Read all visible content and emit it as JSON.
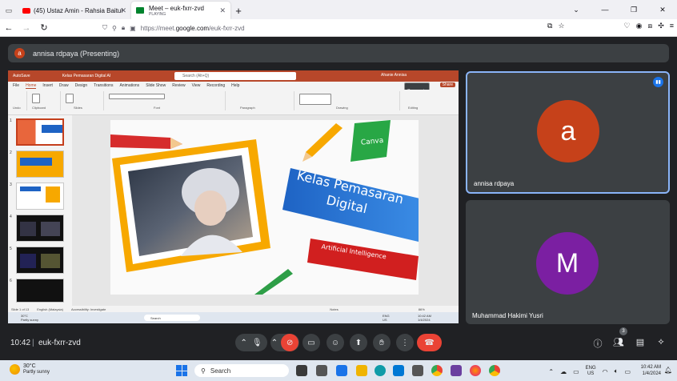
{
  "browser": {
    "tabs": [
      {
        "title": "(45) Ustaz Amin - Rahsia Baitul"
      },
      {
        "title": "Meet – euk-fxrr-zvd",
        "subtitle": "PLAYING"
      }
    ],
    "url_prefix": "https://meet.",
    "url_domain": "google.com",
    "url_path": "/euk-fxrr-zvd"
  },
  "meet": {
    "presenting_initial": "a",
    "presenting_label": "annisa rdpaya (Presenting)",
    "participants": [
      {
        "initial": "a",
        "name": "annisa rdpaya",
        "color": "#c6411a"
      },
      {
        "initial": "M",
        "name": "Muhammad Hakimi Yusri",
        "color": "#7b1fa2"
      }
    ],
    "time": "10:42",
    "separator": "|",
    "meeting_code": "euk-fxrr-zvd",
    "participant_count": "3"
  },
  "ppt": {
    "autosave": "AutoSave",
    "file_name": "Kelas Pemasaran Digital AI",
    "search": "Search (Alt+Q)",
    "user": "Ahanie Annisa",
    "menu": [
      "File",
      "Home",
      "Insert",
      "Draw",
      "Design",
      "Transitions",
      "Animations",
      "Slide Show",
      "Review",
      "View",
      "Recording",
      "Help"
    ],
    "comments": "Comments",
    "share": "Share",
    "ribbon_groups": [
      "Undo",
      "Clipboard",
      "Slides",
      "Font",
      "Paragraph",
      "Drawing",
      "Editing"
    ],
    "slide_numbers": [
      "1",
      "2",
      "3",
      "4",
      "5",
      "6"
    ],
    "status_slide": "Slide 1 of 13",
    "status_lang": "English (Malaysia)",
    "status_access": "Accessibility: Investigate",
    "status_notes": "Notes",
    "status_zoom": "86%",
    "slide": {
      "canva": "Canva",
      "title_line1": "Kelas Pemasaran",
      "title_line2": "Digital",
      "subtitle": "Artificial Intelligence"
    },
    "inner_taskbar": {
      "temp": "30°C",
      "cond": "Partly sunny",
      "search": "Search",
      "lang": "ENG",
      "region": "US",
      "time": "10:42 AM",
      "date": "1/4/2024"
    }
  },
  "taskbar": {
    "temp": "30°C",
    "condition": "Partly sunny",
    "search": "Search",
    "lang": "ENG",
    "region": "US",
    "time": "10:42 AM",
    "date": "1/4/2024"
  }
}
